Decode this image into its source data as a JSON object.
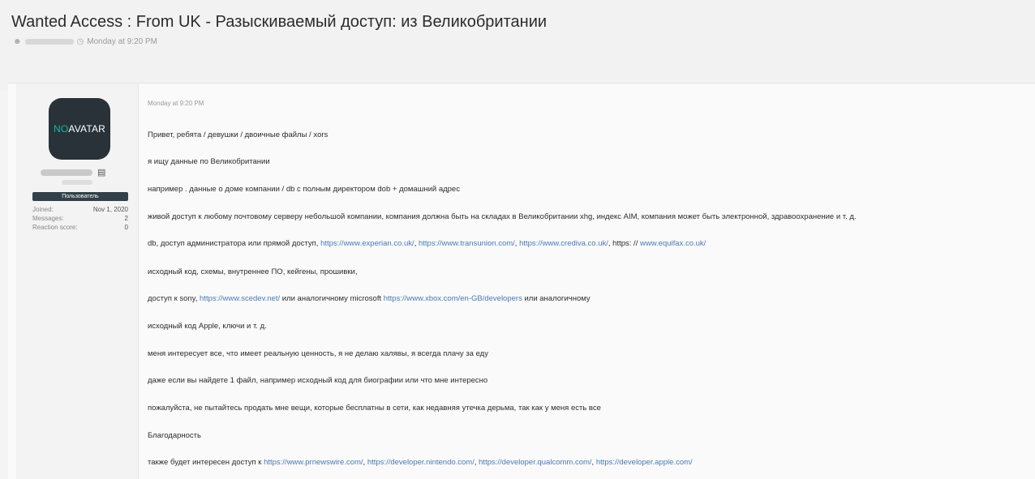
{
  "thread": {
    "title": "Wanted Access : From UK - Разыскиваемый доступ: из Великобритании",
    "meta_time": "Monday at 9:20 PM"
  },
  "user": {
    "avatar_no": "NO",
    "avatar_text": "AVATAR",
    "role": "Пользователь",
    "stats": [
      {
        "label": "Joined:",
        "value": "Nov 1, 2020"
      },
      {
        "label": "Messages:",
        "value": "2"
      },
      {
        "label": "Reaction score:",
        "value": "0"
      }
    ]
  },
  "post": {
    "date": "Monday at 9:20 PM",
    "l1": "Привет, ребята / девушки / двоичные файлы / xors",
    "l2": "я ищу данные по Великобритании",
    "l3": "например . данные о доме компании / db с полным директором dob + домашний адрес",
    "l4": "живой доступ к любому почтовому серверу небольшой компании, компания должна быть на складах в Великобритании xhg, индекс AIM, компания может быть электронной, здравоохранение и т. д.",
    "l5_a": "db, доступ администратора или прямой доступ, ",
    "l5_link1": "https://www.experian.co.uk/",
    "l5_sep1": ", ",
    "l5_link2": "https://www.transunion.com/",
    "l5_sep2": ", ",
    "l5_link3": "https://www.crediva.co.uk/",
    "l5_sep3": ", https: // ",
    "l5_link4": "www.equifax.co.uk/",
    "l6": "исходный код, схемы, внутреннее ПО, кейгены, прошивки,",
    "l7_a": "доступ к sony, ",
    "l7_link1": "https://www.scedev.net/",
    "l7_b": " или аналогичному microsoft ",
    "l7_link2": "https://www.xbox.com/en-GB/developers",
    "l7_c": " или аналогичному",
    "l8": "исходный код Apple, ключи и т. д.",
    "l9": "меня интересует все, что имеет реальную ценность, я не делаю халявы, я всегда плачу за еду",
    "l10": "даже если вы найдете 1 файл, например исходный код для биографии или что мне интересно",
    "l11": "пожалуйста, не пытайтесь продать мне вещи, которые бесплатны в сети, как недавняя утечка дерьма, так как у меня есть все",
    "l12": "Благодарность",
    "l13_a": "также будет интересен доступ к ",
    "l13_link1": "https://www.prnewswire.com/",
    "l13_sep1": ", ",
    "l13_link2": "https://developer.nintendo.com/",
    "l13_sep2": ", ",
    "l13_link3": "https://developer.qualcomm.com/",
    "l13_sep3": ", ",
    "l13_link4": "https://developer.apple.com/"
  }
}
